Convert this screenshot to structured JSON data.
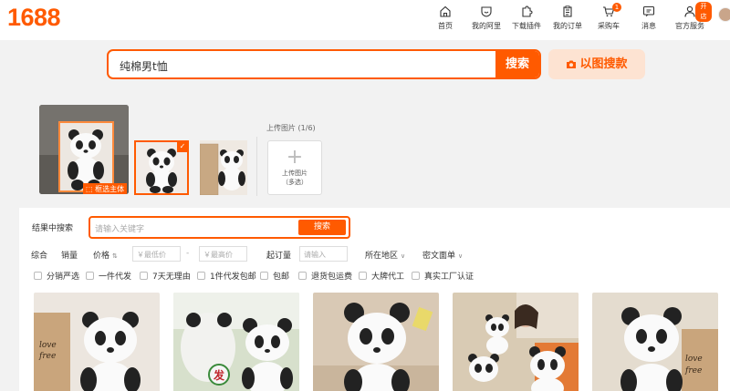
{
  "header": {
    "logo": "1688",
    "nav": [
      {
        "label": "首页",
        "icon": "home-icon"
      },
      {
        "label": "我的阿里",
        "icon": "shield-icon"
      },
      {
        "label": "下载插件",
        "icon": "puzzle-icon"
      },
      {
        "label": "我的订单",
        "icon": "clipboard-icon"
      },
      {
        "label": "采购车",
        "icon": "cart-icon",
        "badge": "1"
      },
      {
        "label": "消息",
        "icon": "message-icon"
      },
      {
        "label": "官方服务",
        "icon": "person-icon",
        "badge": "开店"
      }
    ]
  },
  "search": {
    "query": "纯棉男t恤",
    "button": "搜索",
    "image_search_button": "以图搜款"
  },
  "image_picker": {
    "crop_label": "框选主体",
    "upload_label": "上传图片 (1/6)",
    "upload_box_plus": "+",
    "upload_box_line1": "上传图片",
    "upload_box_line2": "（多选）"
  },
  "results": {
    "inner_search_label": "结果中搜索",
    "inner_search_placeholder": "请输入关键字",
    "inner_search_button": "搜索",
    "sort": [
      "综合",
      "销量",
      "价格"
    ],
    "price_min_placeholder": "￥最低价",
    "price_dash": "-",
    "price_max_placeholder": "￥最高价",
    "moq_label": "起订量",
    "moq_placeholder": "请输入",
    "region": "所在地区",
    "waybill": "密文面单",
    "checkboxes": [
      "分销严选",
      "一件代发",
      "7天无理由",
      "1件代发包邮",
      "包邮",
      "退货包运费",
      "大牌代工",
      "真实工厂认证"
    ]
  },
  "colors": {
    "accent": "#ff5a00",
    "accent_light": "#fde3d2"
  }
}
